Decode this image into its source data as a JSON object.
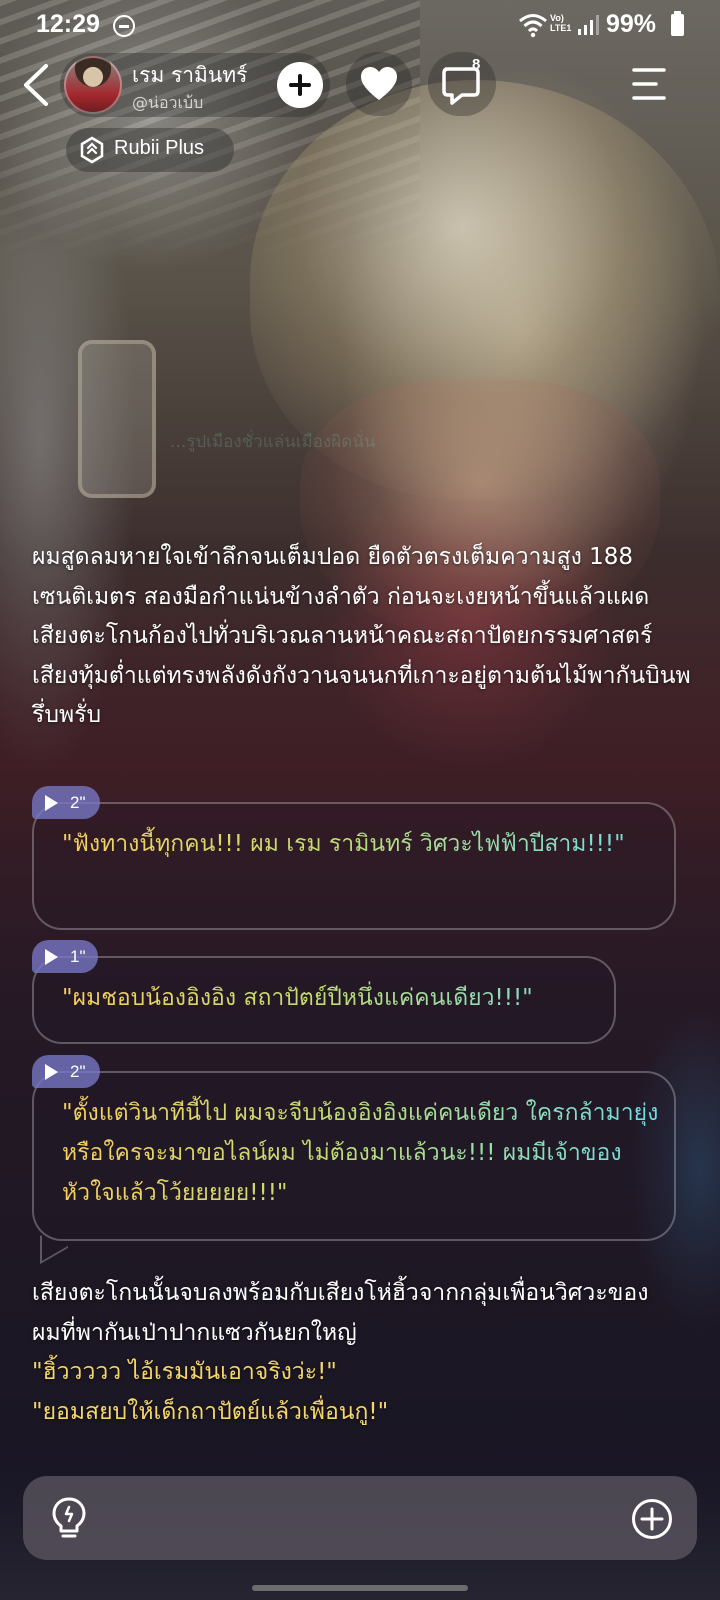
{
  "status_bar": {
    "time": "12:29",
    "lte_label": "Vo)\nLTE1",
    "battery": "99%"
  },
  "header": {
    "character_name": "เรม รามินทร์",
    "character_handle": "@น่อวเบ้บ",
    "chat_count": "8",
    "badge_label": "Rubii Plus"
  },
  "watermark": "...รูปเมืองชั่วแล่นเมืองผิดนั่น",
  "story": {
    "narration_1": "ผมสูดลมหายใจเข้าลึกจนเต็มปอด ยืดตัวตรงเต็มความสูง 188 เซนติเมตร สองมือกำแน่นข้างลำตัว ก่อนจะเงยหน้าขึ้นแล้วแผดเสียงตะโกนก้องไปทั่วบริเวณลานหน้าคณะสถาปัตยกรรมศาสตร์ เสียงทุ้มต่ำแต่ทรงพลังดังกังวานจนนกที่เกาะอยู่ตามต้นไม้พากันบินพรึ่บพรั่บ",
    "dialogues": [
      {
        "duration": "2\"",
        "text": "\"ฟังทางนี้ทุกคน!!! ผม เรม รามินทร์ วิศวะไฟฟ้าปีสาม!!!\""
      },
      {
        "duration": "1\"",
        "text": "\"ผมชอบน้องอิงอิง สถาปัตย์ปีหนึ่งแค่คนเดียว!!!\""
      },
      {
        "duration": "2\"",
        "text": "\"ตั้งแต่วินาทีนี้ไป ผมจะจีบน้องอิงอิงแค่คนเดียว ใครกล้ามายุ่ง หรือใครจะมาขอไลน์ผม ไม่ต้องมาแล้วนะ!!! ผมมีเจ้าของหัวใจแล้วโว้ยยยยย!!!\""
      }
    ],
    "narration_2": "เสียงตะโกนนั้นจบลงพร้อมกับเสียงโห่ฮิ้วจากกลุ่มเพื่อนวิศวะของผมที่พากันเป่าปากแซวกันยกใหญ่",
    "quote_1": "\"ฮิ้ววววว ไอ้เรมมันเอาจริงว่ะ!\"",
    "quote_2": "\"ยอมสยบให้เด็กถาปัตย์แล้วเพื่อนกู!\""
  },
  "colors": {
    "quote_gold": "#f5d66b",
    "voice_tag": "#7878c8",
    "gradient_start": "#f7cf5e",
    "gradient_end": "#6cdde6"
  },
  "icons": [
    "back-arrow-icon",
    "plus-icon",
    "heart-icon",
    "chat-bubble-icon",
    "menu-icon",
    "rubii-logo-icon",
    "lightbulb-icon",
    "add-circle-icon",
    "play-icon"
  ]
}
